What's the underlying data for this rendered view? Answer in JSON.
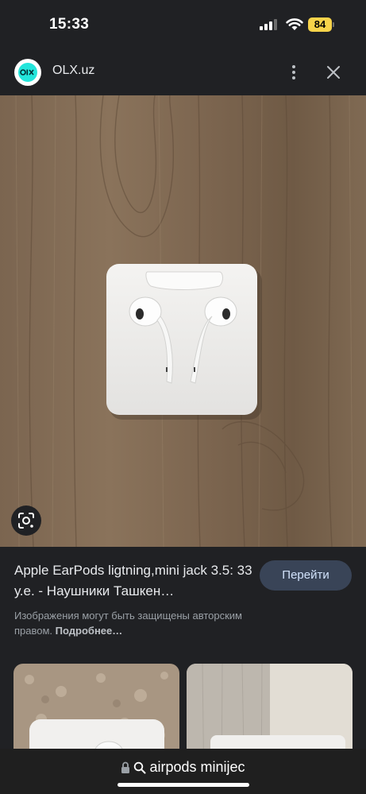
{
  "status_bar": {
    "time": "15:33",
    "battery": "84"
  },
  "source": {
    "logo_text": "OL X",
    "site_name": "OLX.uz"
  },
  "result": {
    "title": "Apple EarPods ligtning,mini jack 3.5: 33 у.е. - Наушники Ташкен…",
    "visit_label": "Перейти",
    "copyright_text": "Изображения могут быть защищены авторским правом.",
    "learn_more": "Подробнее…"
  },
  "address_bar": {
    "url": "airpods minijec"
  },
  "colors": {
    "background": "#202124",
    "button_bg": "#394457",
    "olx_teal": "#23e5db",
    "battery": "#f7d34a"
  },
  "icons": [
    "signal-icon",
    "wifi-icon",
    "more-vert-icon",
    "close-icon",
    "lens-icon",
    "lock-icon",
    "search-icon"
  ]
}
